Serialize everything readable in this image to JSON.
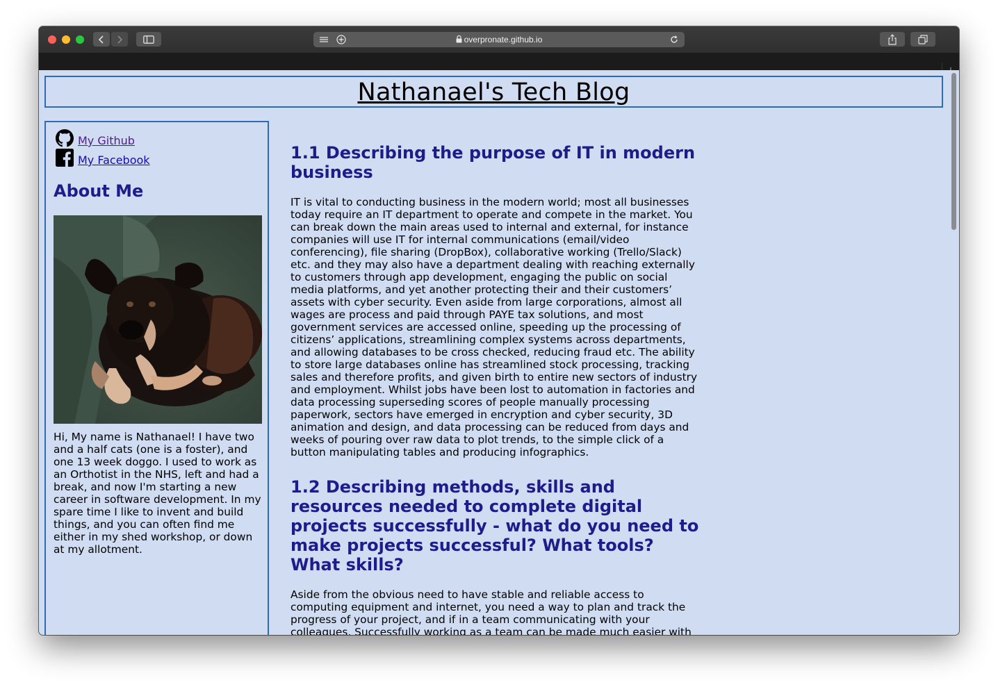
{
  "browser": {
    "url": "overpronate.github.io"
  },
  "page": {
    "title": "Nathanael's Tech Blog"
  },
  "sidebar": {
    "links": [
      {
        "label": "My Github",
        "icon": "github-icon"
      },
      {
        "label": "My Facebook",
        "icon": "facebook-icon"
      }
    ],
    "about_title": "About Me",
    "about_text": "Hi, My name is Nathanael! I have two and a half cats (one is a foster), and one 13 week doggo. I used to work as an Orthotist in the NHS, left and had a break, and now I'm starting a new career in software development. In my spare time I like to invent and build things, and you can often find me either in my shed workshop, or down at my allotment."
  },
  "articles": [
    {
      "heading": "1.1 Describing the purpose of IT in modern business",
      "body": "IT is vital to conducting business in the modern world; most all businesses today require an IT department to operate and compete in the market. You can break down the main areas used to internal and external, for instance companies will use IT for internal communications (email/video conferencing), file sharing (DropBox), collaborative working (Trello/Slack) etc. and they may also have a department dealing with reaching externally to customers through app development, engaging the public on social media platforms, and yet another protecting their and their customers’ assets with cyber security. Even aside from large corporations, almost all wages are process and paid through PAYE tax solutions, and most government services are accessed online, speeding up the processing of citizens’ applications, streamlining complex systems across departments, and allowing databases to be cross checked, reducing fraud etc. The ability to store large databases online has streamlined stock processing, tracking sales and therefore profits, and given birth to entire new sectors of industry and employment. Whilst jobs have been lost to automation in factories and data processing superseding scores of people manually processing paperwork, sectors have emerged in encryption and cyber security, 3D animation and design, and data processing can be reduced from days and weeks of pouring over raw data to plot trends, to the simple click of a button manipulating tables and producing infographics."
    },
    {
      "heading": "1.2 Describing methods, skills and resources needed to complete digital projects successfully - what do you need to make projects successful? What tools? What skills?",
      "body": "Aside from the obvious need to have stable and reliable access to computing equipment and internet, you need a way to plan and track the progress of your project, and if in a team communicating with your colleagues. Successfully working as a team can be made much easier with instantly collaborative programs such as Trello and Jira, open communication such as Stand Ups, and having a team structure massively aids its productivity, and prevents stepping on each others cyber toes. In a"
    }
  ],
  "colors": {
    "page_background": "#cfdcf2",
    "border": "#2e6bb0",
    "heading": "#1c1c8a",
    "link": "#1a0dab"
  }
}
